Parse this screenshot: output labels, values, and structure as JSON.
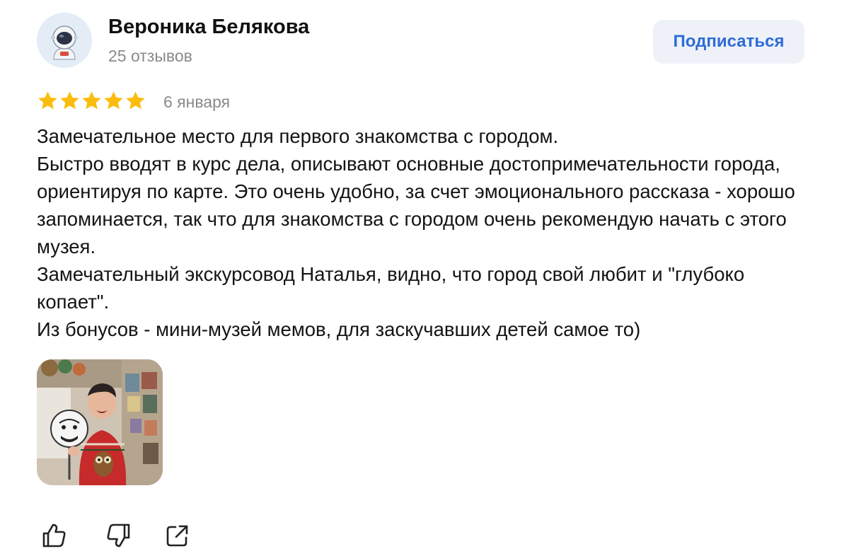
{
  "author": {
    "name": "Вероника Белякова",
    "reviews_count": "25 отзывов",
    "avatar_icon": "astronaut-icon"
  },
  "subscribe_label": "Подписаться",
  "rating": {
    "stars": 5,
    "max": 5,
    "date": "6 января"
  },
  "review_lines": [
    "Замечательное место для первого знакомства с городом.",
    "Быстро вводят в курс дела, описывают основные достопримечательности города, ориентируя по карте. Это очень удобно, за счет эмоционального рассказа - хорошо запоминается, так что для знакомства с городом очень рекомендую начать с этого музея.",
    "Замечательный экскурсовод Наталья, видно, что город свой любит и \"глубоко копает\".",
    "Из бонусов - мини-музей мемов, для заскучавших детей самое то)"
  ],
  "actions": [
    {
      "icon": "thumbs-up-icon"
    },
    {
      "icon": "thumbs-down-icon"
    },
    {
      "icon": "share-icon"
    }
  ],
  "colors": {
    "accent": "#2f6bd8",
    "star": "#fbbd0d",
    "muted_text": "#8a8a8a",
    "button_bg": "#eef2f8"
  }
}
